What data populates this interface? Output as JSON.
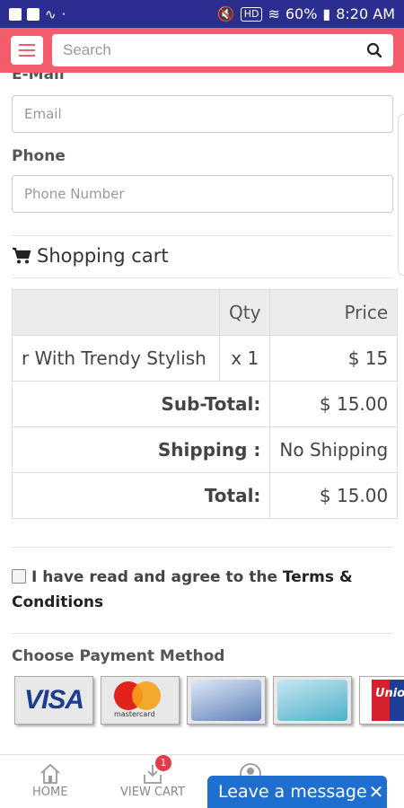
{
  "status_bar": {
    "time": "8:20 AM",
    "battery": "60%",
    "hd": "HD"
  },
  "header": {
    "search_placeholder": "Search"
  },
  "form": {
    "email_label": "E-Mail",
    "email_placeholder": "Email",
    "phone_label": "Phone",
    "phone_placeholder": "Phone Number"
  },
  "cart": {
    "title": "Shopping cart",
    "columns": {
      "product": "",
      "qty": "Qty",
      "price": "Price"
    },
    "item": {
      "name": "r With Trendy Stylish",
      "qty": "x 1",
      "price": "$ 15"
    },
    "subtotal_label": "Sub-Total:",
    "subtotal_value": "$ 15.00",
    "shipping_label": "Shipping :",
    "shipping_value": "No Shipping",
    "total_label": "Total:",
    "total_value": "$ 15.00"
  },
  "terms": {
    "text": "I have read and agree to the ",
    "link": "Terms & Conditions"
  },
  "payment": {
    "title": "Choose Payment Method",
    "methods": [
      "VISA",
      "mastercard",
      "",
      "",
      "Union"
    ]
  },
  "bottom_nav": {
    "home": "HOME",
    "view_cart": "VIEW CART",
    "cart_count": "1"
  },
  "chat": {
    "label": "Leave a message",
    "close": "✕"
  }
}
